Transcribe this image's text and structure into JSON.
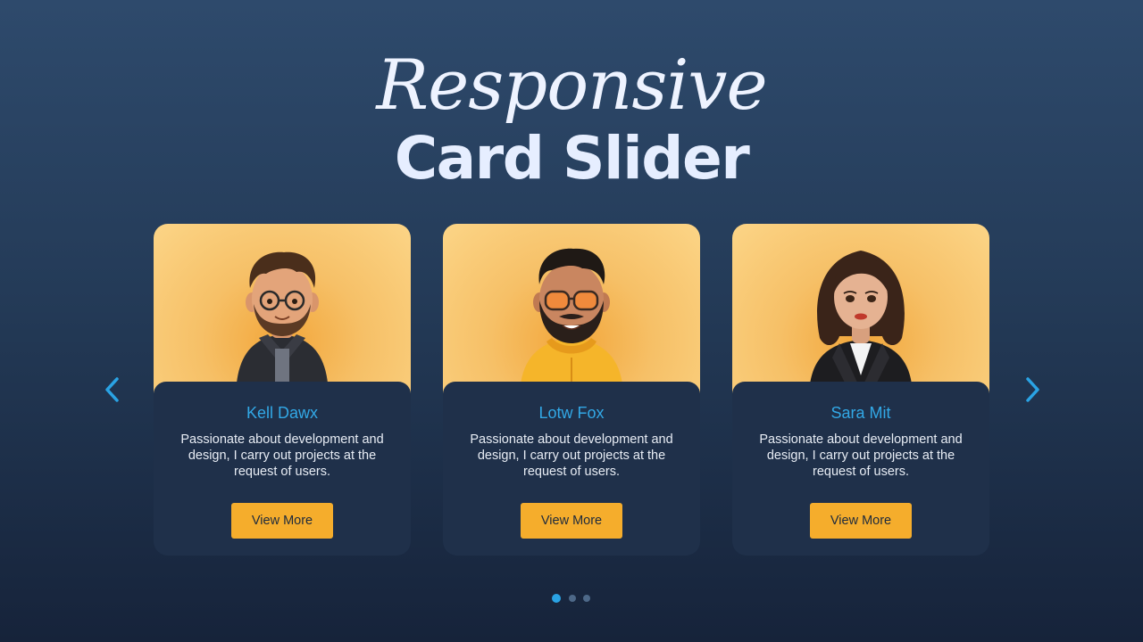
{
  "heading": {
    "script": "Responsive",
    "main": "Card Slider"
  },
  "cards": [
    {
      "name": "Kell Dawx",
      "description": "Passionate about development and design, I carry out projects at the request of users.",
      "button": "View More",
      "avatar_icon": "man-glasses-hoodie-avatar"
    },
    {
      "name": "Lotw Fox",
      "description": "Passionate about development and design, I carry out projects at the request of users.",
      "button": "View More",
      "avatar_icon": "man-beard-sunglasses-avatar"
    },
    {
      "name": "Sara Mit",
      "description": "Passionate about development and design, I carry out projects at the request of users.",
      "button": "View More",
      "avatar_icon": "woman-black-jacket-avatar"
    }
  ],
  "pagination": {
    "count": 3,
    "active_index": 0
  },
  "colors": {
    "accent": "#2aa3e4",
    "button": "#f5ad2c",
    "card": "#1f304a",
    "card_image": "#f6c067"
  }
}
